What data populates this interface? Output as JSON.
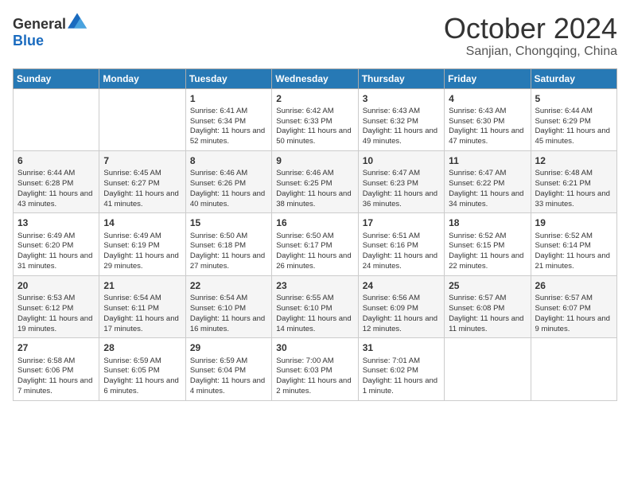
{
  "header": {
    "logo": {
      "general": "General",
      "blue": "Blue"
    },
    "title": "October 2024",
    "location": "Sanjian, Chongqing, China"
  },
  "weekdays": [
    "Sunday",
    "Monday",
    "Tuesday",
    "Wednesday",
    "Thursday",
    "Friday",
    "Saturday"
  ],
  "weeks": [
    [
      {
        "day": "",
        "empty": true
      },
      {
        "day": "",
        "empty": true
      },
      {
        "day": "1",
        "sunrise": "6:41 AM",
        "sunset": "6:34 PM",
        "daylight": "11 hours and 52 minutes."
      },
      {
        "day": "2",
        "sunrise": "6:42 AM",
        "sunset": "6:33 PM",
        "daylight": "11 hours and 50 minutes."
      },
      {
        "day": "3",
        "sunrise": "6:43 AM",
        "sunset": "6:32 PM",
        "daylight": "11 hours and 49 minutes."
      },
      {
        "day": "4",
        "sunrise": "6:43 AM",
        "sunset": "6:30 PM",
        "daylight": "11 hours and 47 minutes."
      },
      {
        "day": "5",
        "sunrise": "6:44 AM",
        "sunset": "6:29 PM",
        "daylight": "11 hours and 45 minutes."
      }
    ],
    [
      {
        "day": "6",
        "sunrise": "6:44 AM",
        "sunset": "6:28 PM",
        "daylight": "11 hours and 43 minutes."
      },
      {
        "day": "7",
        "sunrise": "6:45 AM",
        "sunset": "6:27 PM",
        "daylight": "11 hours and 41 minutes."
      },
      {
        "day": "8",
        "sunrise": "6:46 AM",
        "sunset": "6:26 PM",
        "daylight": "11 hours and 40 minutes."
      },
      {
        "day": "9",
        "sunrise": "6:46 AM",
        "sunset": "6:25 PM",
        "daylight": "11 hours and 38 minutes."
      },
      {
        "day": "10",
        "sunrise": "6:47 AM",
        "sunset": "6:23 PM",
        "daylight": "11 hours and 36 minutes."
      },
      {
        "day": "11",
        "sunrise": "6:47 AM",
        "sunset": "6:22 PM",
        "daylight": "11 hours and 34 minutes."
      },
      {
        "day": "12",
        "sunrise": "6:48 AM",
        "sunset": "6:21 PM",
        "daylight": "11 hours and 33 minutes."
      }
    ],
    [
      {
        "day": "13",
        "sunrise": "6:49 AM",
        "sunset": "6:20 PM",
        "daylight": "11 hours and 31 minutes."
      },
      {
        "day": "14",
        "sunrise": "6:49 AM",
        "sunset": "6:19 PM",
        "daylight": "11 hours and 29 minutes."
      },
      {
        "day": "15",
        "sunrise": "6:50 AM",
        "sunset": "6:18 PM",
        "daylight": "11 hours and 27 minutes."
      },
      {
        "day": "16",
        "sunrise": "6:50 AM",
        "sunset": "6:17 PM",
        "daylight": "11 hours and 26 minutes."
      },
      {
        "day": "17",
        "sunrise": "6:51 AM",
        "sunset": "6:16 PM",
        "daylight": "11 hours and 24 minutes."
      },
      {
        "day": "18",
        "sunrise": "6:52 AM",
        "sunset": "6:15 PM",
        "daylight": "11 hours and 22 minutes."
      },
      {
        "day": "19",
        "sunrise": "6:52 AM",
        "sunset": "6:14 PM",
        "daylight": "11 hours and 21 minutes."
      }
    ],
    [
      {
        "day": "20",
        "sunrise": "6:53 AM",
        "sunset": "6:12 PM",
        "daylight": "11 hours and 19 minutes."
      },
      {
        "day": "21",
        "sunrise": "6:54 AM",
        "sunset": "6:11 PM",
        "daylight": "11 hours and 17 minutes."
      },
      {
        "day": "22",
        "sunrise": "6:54 AM",
        "sunset": "6:10 PM",
        "daylight": "11 hours and 16 minutes."
      },
      {
        "day": "23",
        "sunrise": "6:55 AM",
        "sunset": "6:10 PM",
        "daylight": "11 hours and 14 minutes."
      },
      {
        "day": "24",
        "sunrise": "6:56 AM",
        "sunset": "6:09 PM",
        "daylight": "11 hours and 12 minutes."
      },
      {
        "day": "25",
        "sunrise": "6:57 AM",
        "sunset": "6:08 PM",
        "daylight": "11 hours and 11 minutes."
      },
      {
        "day": "26",
        "sunrise": "6:57 AM",
        "sunset": "6:07 PM",
        "daylight": "11 hours and 9 minutes."
      }
    ],
    [
      {
        "day": "27",
        "sunrise": "6:58 AM",
        "sunset": "6:06 PM",
        "daylight": "11 hours and 7 minutes."
      },
      {
        "day": "28",
        "sunrise": "6:59 AM",
        "sunset": "6:05 PM",
        "daylight": "11 hours and 6 minutes."
      },
      {
        "day": "29",
        "sunrise": "6:59 AM",
        "sunset": "6:04 PM",
        "daylight": "11 hours and 4 minutes."
      },
      {
        "day": "30",
        "sunrise": "7:00 AM",
        "sunset": "6:03 PM",
        "daylight": "11 hours and 2 minutes."
      },
      {
        "day": "31",
        "sunrise": "7:01 AM",
        "sunset": "6:02 PM",
        "daylight": "11 hours and 1 minute."
      },
      {
        "day": "",
        "empty": true
      },
      {
        "day": "",
        "empty": true
      }
    ]
  ],
  "labels": {
    "sunrise": "Sunrise:",
    "sunset": "Sunset:",
    "daylight": "Daylight:"
  }
}
